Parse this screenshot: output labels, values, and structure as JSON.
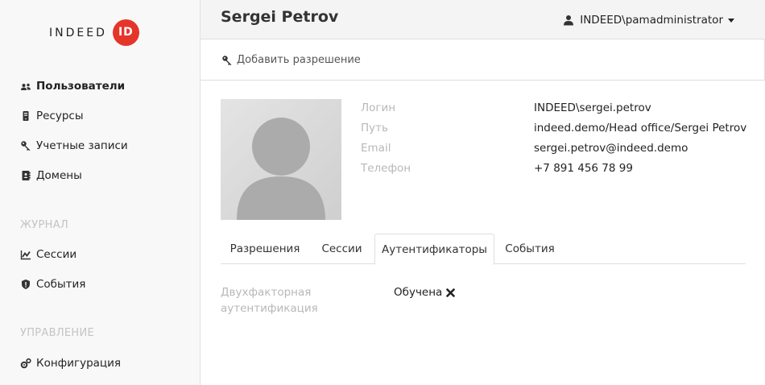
{
  "logo": {
    "text": "INDEED",
    "badge": "ID"
  },
  "sidebar": {
    "items": [
      {
        "label": "Пользователи",
        "icon": "users-icon"
      },
      {
        "label": "Ресурсы",
        "icon": "server-icon"
      },
      {
        "label": "Учетные записи",
        "icon": "key-icon"
      },
      {
        "label": "Домены",
        "icon": "address-book-icon"
      }
    ],
    "journal_heading": "ЖУРНАЛ",
    "journal_items": [
      {
        "label": "Сессии",
        "icon": "chart-icon"
      },
      {
        "label": "События",
        "icon": "shield-alert-icon"
      }
    ],
    "manage_heading": "УПРАВЛЕНИЕ",
    "manage_items": [
      {
        "label": "Конфигурация",
        "icon": "cogs-icon"
      }
    ]
  },
  "header": {
    "title": "Sergei Petrov",
    "user": "INDEED\\pamadministrator"
  },
  "toolbar": {
    "add_permission": "Добавить разрешение"
  },
  "profile": {
    "fields": [
      {
        "label": "Логин",
        "value": "INDEED\\sergei.petrov"
      },
      {
        "label": "Путь",
        "value": "indeed.demo/Head office/Sergei Petrov"
      },
      {
        "label": "Email",
        "value": "sergei.petrov@indeed.demo"
      },
      {
        "label": "Телефон",
        "value": "+7 891 456 78 99"
      }
    ]
  },
  "tabs": [
    {
      "label": "Разрешения"
    },
    {
      "label": "Сессии"
    },
    {
      "label": "Аутентификаторы"
    },
    {
      "label": "События"
    }
  ],
  "authenticators": {
    "label_line1": "Двухфакторная",
    "label_line2": "аутентификация",
    "status": "Обучена"
  },
  "colors": {
    "accent": "#e5352b",
    "muted": "#b8b8b8",
    "sidebar_bg": "#f8f8f8"
  }
}
